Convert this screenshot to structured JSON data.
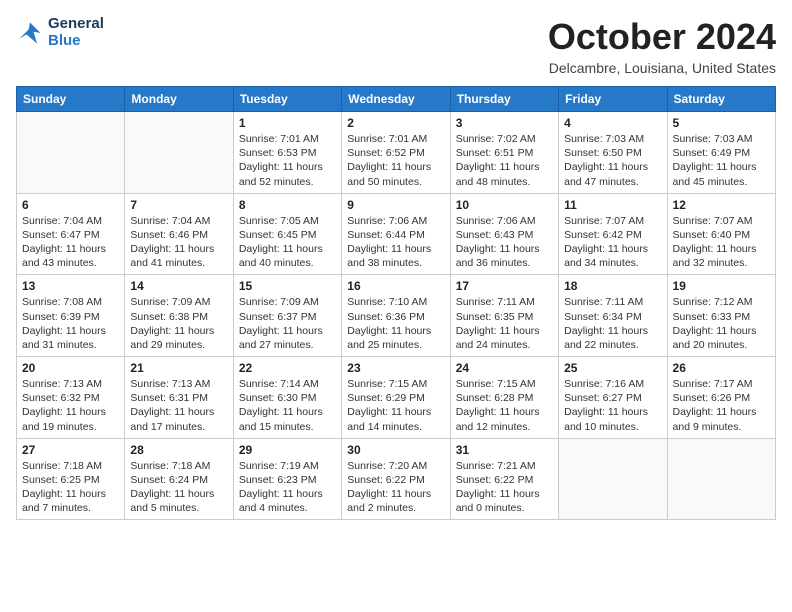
{
  "header": {
    "logo_general": "General",
    "logo_blue": "Blue",
    "month_title": "October 2024",
    "location": "Delcambre, Louisiana, United States"
  },
  "days_of_week": [
    "Sunday",
    "Monday",
    "Tuesday",
    "Wednesday",
    "Thursday",
    "Friday",
    "Saturday"
  ],
  "weeks": [
    [
      {
        "day": "",
        "info": ""
      },
      {
        "day": "",
        "info": ""
      },
      {
        "day": "1",
        "info": "Sunrise: 7:01 AM\nSunset: 6:53 PM\nDaylight: 11 hours and 52 minutes."
      },
      {
        "day": "2",
        "info": "Sunrise: 7:01 AM\nSunset: 6:52 PM\nDaylight: 11 hours and 50 minutes."
      },
      {
        "day": "3",
        "info": "Sunrise: 7:02 AM\nSunset: 6:51 PM\nDaylight: 11 hours and 48 minutes."
      },
      {
        "day": "4",
        "info": "Sunrise: 7:03 AM\nSunset: 6:50 PM\nDaylight: 11 hours and 47 minutes."
      },
      {
        "day": "5",
        "info": "Sunrise: 7:03 AM\nSunset: 6:49 PM\nDaylight: 11 hours and 45 minutes."
      }
    ],
    [
      {
        "day": "6",
        "info": "Sunrise: 7:04 AM\nSunset: 6:47 PM\nDaylight: 11 hours and 43 minutes."
      },
      {
        "day": "7",
        "info": "Sunrise: 7:04 AM\nSunset: 6:46 PM\nDaylight: 11 hours and 41 minutes."
      },
      {
        "day": "8",
        "info": "Sunrise: 7:05 AM\nSunset: 6:45 PM\nDaylight: 11 hours and 40 minutes."
      },
      {
        "day": "9",
        "info": "Sunrise: 7:06 AM\nSunset: 6:44 PM\nDaylight: 11 hours and 38 minutes."
      },
      {
        "day": "10",
        "info": "Sunrise: 7:06 AM\nSunset: 6:43 PM\nDaylight: 11 hours and 36 minutes."
      },
      {
        "day": "11",
        "info": "Sunrise: 7:07 AM\nSunset: 6:42 PM\nDaylight: 11 hours and 34 minutes."
      },
      {
        "day": "12",
        "info": "Sunrise: 7:07 AM\nSunset: 6:40 PM\nDaylight: 11 hours and 32 minutes."
      }
    ],
    [
      {
        "day": "13",
        "info": "Sunrise: 7:08 AM\nSunset: 6:39 PM\nDaylight: 11 hours and 31 minutes."
      },
      {
        "day": "14",
        "info": "Sunrise: 7:09 AM\nSunset: 6:38 PM\nDaylight: 11 hours and 29 minutes."
      },
      {
        "day": "15",
        "info": "Sunrise: 7:09 AM\nSunset: 6:37 PM\nDaylight: 11 hours and 27 minutes."
      },
      {
        "day": "16",
        "info": "Sunrise: 7:10 AM\nSunset: 6:36 PM\nDaylight: 11 hours and 25 minutes."
      },
      {
        "day": "17",
        "info": "Sunrise: 7:11 AM\nSunset: 6:35 PM\nDaylight: 11 hours and 24 minutes."
      },
      {
        "day": "18",
        "info": "Sunrise: 7:11 AM\nSunset: 6:34 PM\nDaylight: 11 hours and 22 minutes."
      },
      {
        "day": "19",
        "info": "Sunrise: 7:12 AM\nSunset: 6:33 PM\nDaylight: 11 hours and 20 minutes."
      }
    ],
    [
      {
        "day": "20",
        "info": "Sunrise: 7:13 AM\nSunset: 6:32 PM\nDaylight: 11 hours and 19 minutes."
      },
      {
        "day": "21",
        "info": "Sunrise: 7:13 AM\nSunset: 6:31 PM\nDaylight: 11 hours and 17 minutes."
      },
      {
        "day": "22",
        "info": "Sunrise: 7:14 AM\nSunset: 6:30 PM\nDaylight: 11 hours and 15 minutes."
      },
      {
        "day": "23",
        "info": "Sunrise: 7:15 AM\nSunset: 6:29 PM\nDaylight: 11 hours and 14 minutes."
      },
      {
        "day": "24",
        "info": "Sunrise: 7:15 AM\nSunset: 6:28 PM\nDaylight: 11 hours and 12 minutes."
      },
      {
        "day": "25",
        "info": "Sunrise: 7:16 AM\nSunset: 6:27 PM\nDaylight: 11 hours and 10 minutes."
      },
      {
        "day": "26",
        "info": "Sunrise: 7:17 AM\nSunset: 6:26 PM\nDaylight: 11 hours and 9 minutes."
      }
    ],
    [
      {
        "day": "27",
        "info": "Sunrise: 7:18 AM\nSunset: 6:25 PM\nDaylight: 11 hours and 7 minutes."
      },
      {
        "day": "28",
        "info": "Sunrise: 7:18 AM\nSunset: 6:24 PM\nDaylight: 11 hours and 5 minutes."
      },
      {
        "day": "29",
        "info": "Sunrise: 7:19 AM\nSunset: 6:23 PM\nDaylight: 11 hours and 4 minutes."
      },
      {
        "day": "30",
        "info": "Sunrise: 7:20 AM\nSunset: 6:22 PM\nDaylight: 11 hours and 2 minutes."
      },
      {
        "day": "31",
        "info": "Sunrise: 7:21 AM\nSunset: 6:22 PM\nDaylight: 11 hours and 0 minutes."
      },
      {
        "day": "",
        "info": ""
      },
      {
        "day": "",
        "info": ""
      }
    ]
  ]
}
